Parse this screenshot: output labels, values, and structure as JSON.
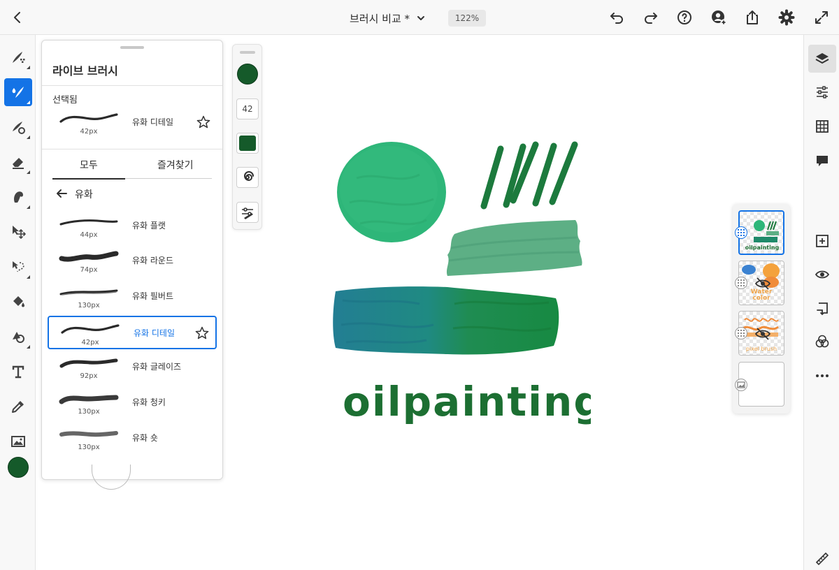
{
  "header": {
    "doc_title": "브러시 비교 *",
    "zoom": "122%"
  },
  "brush_panel": {
    "title": "라이브 브러시",
    "selected_label": "선택됨",
    "selected_brush": {
      "name": "유화 디테일",
      "size": "42px"
    },
    "tabs": [
      "모두",
      "즐겨찾기"
    ],
    "active_tab": 0,
    "category": "유화",
    "brushes": [
      {
        "name": "유화 플랫",
        "size": "44px"
      },
      {
        "name": "유화 라운드",
        "size": "74px"
      },
      {
        "name": "유화 필버트",
        "size": "130px"
      },
      {
        "name": "유화 디테일",
        "size": "42px",
        "selected": true
      },
      {
        "name": "유화 글레이즈",
        "size": "92px"
      },
      {
        "name": "유화 청키",
        "size": "130px"
      },
      {
        "name": "유화 숏",
        "size": "130px"
      }
    ]
  },
  "mini_panel": {
    "brush_size": "42",
    "color": "#155a2a"
  },
  "canvas": {
    "text": "oilpainting"
  },
  "layers": {
    "thumb_texts": [
      "oilpainting",
      "Water color",
      "pixel brush"
    ]
  },
  "colors": {
    "accent": "#1473e6",
    "current_color": "#155a2a"
  }
}
